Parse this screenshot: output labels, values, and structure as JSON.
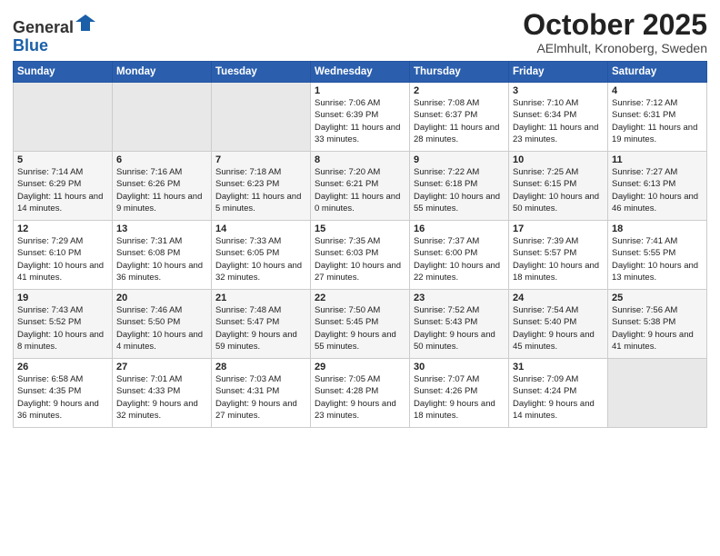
{
  "logo": {
    "general": "General",
    "blue": "Blue"
  },
  "header": {
    "title": "October 2025",
    "subtitle": "AElmhult, Kronoberg, Sweden"
  },
  "days_of_week": [
    "Sunday",
    "Monday",
    "Tuesday",
    "Wednesday",
    "Thursday",
    "Friday",
    "Saturday"
  ],
  "weeks": [
    [
      {
        "day": "",
        "info": ""
      },
      {
        "day": "",
        "info": ""
      },
      {
        "day": "",
        "info": ""
      },
      {
        "day": "1",
        "info": "Sunrise: 7:06 AM\nSunset: 6:39 PM\nDaylight: 11 hours and 33 minutes."
      },
      {
        "day": "2",
        "info": "Sunrise: 7:08 AM\nSunset: 6:37 PM\nDaylight: 11 hours and 28 minutes."
      },
      {
        "day": "3",
        "info": "Sunrise: 7:10 AM\nSunset: 6:34 PM\nDaylight: 11 hours and 23 minutes."
      },
      {
        "day": "4",
        "info": "Sunrise: 7:12 AM\nSunset: 6:31 PM\nDaylight: 11 hours and 19 minutes."
      }
    ],
    [
      {
        "day": "5",
        "info": "Sunrise: 7:14 AM\nSunset: 6:29 PM\nDaylight: 11 hours and 14 minutes."
      },
      {
        "day": "6",
        "info": "Sunrise: 7:16 AM\nSunset: 6:26 PM\nDaylight: 11 hours and 9 minutes."
      },
      {
        "day": "7",
        "info": "Sunrise: 7:18 AM\nSunset: 6:23 PM\nDaylight: 11 hours and 5 minutes."
      },
      {
        "day": "8",
        "info": "Sunrise: 7:20 AM\nSunset: 6:21 PM\nDaylight: 11 hours and 0 minutes."
      },
      {
        "day": "9",
        "info": "Sunrise: 7:22 AM\nSunset: 6:18 PM\nDaylight: 10 hours and 55 minutes."
      },
      {
        "day": "10",
        "info": "Sunrise: 7:25 AM\nSunset: 6:15 PM\nDaylight: 10 hours and 50 minutes."
      },
      {
        "day": "11",
        "info": "Sunrise: 7:27 AM\nSunset: 6:13 PM\nDaylight: 10 hours and 46 minutes."
      }
    ],
    [
      {
        "day": "12",
        "info": "Sunrise: 7:29 AM\nSunset: 6:10 PM\nDaylight: 10 hours and 41 minutes."
      },
      {
        "day": "13",
        "info": "Sunrise: 7:31 AM\nSunset: 6:08 PM\nDaylight: 10 hours and 36 minutes."
      },
      {
        "day": "14",
        "info": "Sunrise: 7:33 AM\nSunset: 6:05 PM\nDaylight: 10 hours and 32 minutes."
      },
      {
        "day": "15",
        "info": "Sunrise: 7:35 AM\nSunset: 6:03 PM\nDaylight: 10 hours and 27 minutes."
      },
      {
        "day": "16",
        "info": "Sunrise: 7:37 AM\nSunset: 6:00 PM\nDaylight: 10 hours and 22 minutes."
      },
      {
        "day": "17",
        "info": "Sunrise: 7:39 AM\nSunset: 5:57 PM\nDaylight: 10 hours and 18 minutes."
      },
      {
        "day": "18",
        "info": "Sunrise: 7:41 AM\nSunset: 5:55 PM\nDaylight: 10 hours and 13 minutes."
      }
    ],
    [
      {
        "day": "19",
        "info": "Sunrise: 7:43 AM\nSunset: 5:52 PM\nDaylight: 10 hours and 8 minutes."
      },
      {
        "day": "20",
        "info": "Sunrise: 7:46 AM\nSunset: 5:50 PM\nDaylight: 10 hours and 4 minutes."
      },
      {
        "day": "21",
        "info": "Sunrise: 7:48 AM\nSunset: 5:47 PM\nDaylight: 9 hours and 59 minutes."
      },
      {
        "day": "22",
        "info": "Sunrise: 7:50 AM\nSunset: 5:45 PM\nDaylight: 9 hours and 55 minutes."
      },
      {
        "day": "23",
        "info": "Sunrise: 7:52 AM\nSunset: 5:43 PM\nDaylight: 9 hours and 50 minutes."
      },
      {
        "day": "24",
        "info": "Sunrise: 7:54 AM\nSunset: 5:40 PM\nDaylight: 9 hours and 45 minutes."
      },
      {
        "day": "25",
        "info": "Sunrise: 7:56 AM\nSunset: 5:38 PM\nDaylight: 9 hours and 41 minutes."
      }
    ],
    [
      {
        "day": "26",
        "info": "Sunrise: 6:58 AM\nSunset: 4:35 PM\nDaylight: 9 hours and 36 minutes."
      },
      {
        "day": "27",
        "info": "Sunrise: 7:01 AM\nSunset: 4:33 PM\nDaylight: 9 hours and 32 minutes."
      },
      {
        "day": "28",
        "info": "Sunrise: 7:03 AM\nSunset: 4:31 PM\nDaylight: 9 hours and 27 minutes."
      },
      {
        "day": "29",
        "info": "Sunrise: 7:05 AM\nSunset: 4:28 PM\nDaylight: 9 hours and 23 minutes."
      },
      {
        "day": "30",
        "info": "Sunrise: 7:07 AM\nSunset: 4:26 PM\nDaylight: 9 hours and 18 minutes."
      },
      {
        "day": "31",
        "info": "Sunrise: 7:09 AM\nSunset: 4:24 PM\nDaylight: 9 hours and 14 minutes."
      },
      {
        "day": "",
        "info": ""
      }
    ]
  ]
}
